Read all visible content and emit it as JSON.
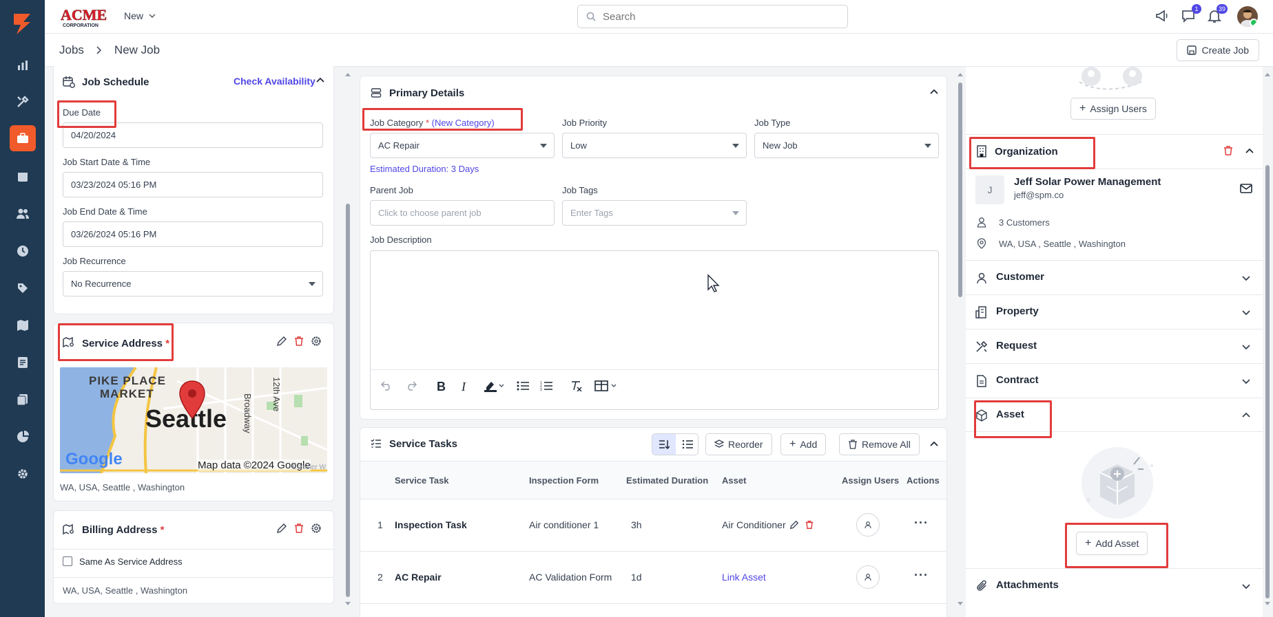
{
  "brand": {
    "name": "ACME",
    "sub": "CORPORATION"
  },
  "topbar": {
    "new_label": "New",
    "search_placeholder": "Search",
    "chat_badge": "1",
    "bell_badge": "39"
  },
  "breadcrumb": {
    "parent": "Jobs",
    "current": "New Job"
  },
  "header": {
    "create_job": "Create Job"
  },
  "schedule": {
    "title": "Job Schedule",
    "check_availability": "Check Availability",
    "due_label": "Due Date",
    "due_value": "04/20/2024",
    "start_label": "Job Start Date & Time",
    "start_value": "03/23/2024 05:16 PM",
    "end_label": "Job End Date & Time",
    "end_value": "03/26/2024 05:16 PM",
    "recur_label": "Job Recurrence",
    "recur_value": "No Recurrence"
  },
  "service_address": {
    "title": "Service Address",
    "required": "*",
    "map": {
      "city": "Seattle",
      "place1": "PIKE PLACE",
      "place2": "MARKET",
      "street1": "Broadway",
      "street2": "12th Ave",
      "google": "Google",
      "credit": "Map data ©2024 Google",
      "edge_label": "E Yesler W"
    },
    "address": "WA, USA, Seattle , Washington"
  },
  "billing_address": {
    "title": "Billing Address",
    "required": "*",
    "same_label": "Same As Service Address",
    "address": "WA, USA, Seattle , Washington"
  },
  "primary": {
    "title": "Primary Details",
    "category_label": "Job Category",
    "category_req": "*",
    "new_category": "(New Category)",
    "category_value": "AC Repair",
    "estimated": "Estimated Duration: 3 Days",
    "priority_label": "Job Priority",
    "priority_value": "Low",
    "type_label": "Job Type",
    "type_value": "New Job",
    "parent_label": "Parent Job",
    "parent_placeholder": "Click to choose parent job",
    "tags_label": "Job Tags",
    "tags_placeholder": "Enter Tags",
    "desc_label": "Job Description"
  },
  "tasks": {
    "title": "Service Tasks",
    "reorder": "Reorder",
    "add": "Add",
    "remove_all": "Remove All",
    "columns": [
      "Service Task",
      "Inspection Form",
      "Estimated Duration",
      "Asset",
      "Assign Users",
      "Actions"
    ],
    "rows": [
      {
        "num": "1",
        "task": "Inspection Task",
        "form": "Air conditioner 1",
        "duration": "3h",
        "asset": "Air Conditioner"
      },
      {
        "num": "2",
        "task": "AC Repair",
        "form": "AC Validation Form",
        "duration": "1d",
        "asset": "Link Asset"
      }
    ]
  },
  "right": {
    "assign_users": "Assign Users",
    "org": {
      "title": "Organization",
      "initial": "J",
      "name": "Jeff Solar Power Management",
      "email": "jeff@spm.co",
      "customers": "3 Customers",
      "location": "WA, USA , Seattle , Washington"
    },
    "sections": {
      "customer": "Customer",
      "property": "Property",
      "request": "Request",
      "contract": "Contract",
      "asset": "Asset",
      "attachments": "Attachments"
    },
    "add_asset": "Add Asset"
  },
  "colors": {
    "nav": "#1f3a52",
    "accent": "#f15a2b",
    "link": "#4f46e5",
    "highlight": "#e23b3b"
  }
}
